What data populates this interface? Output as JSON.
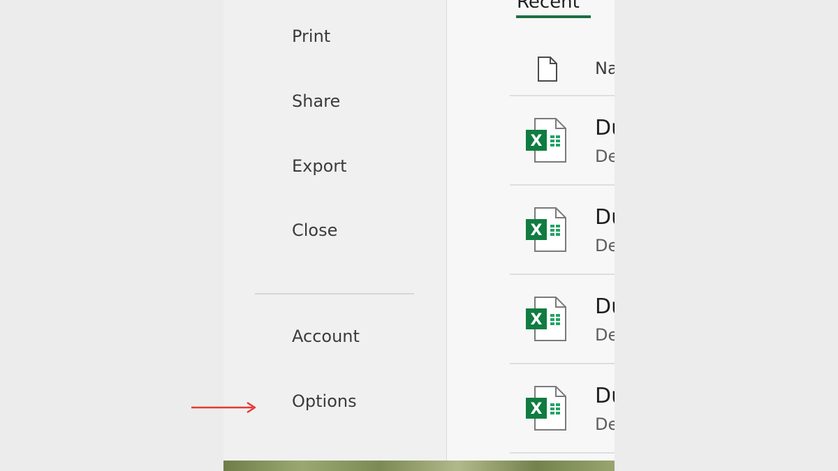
{
  "nav": {
    "items": [
      {
        "label": "Print"
      },
      {
        "label": "Share"
      },
      {
        "label": "Export"
      },
      {
        "label": "Close"
      },
      {
        "label": "Account"
      },
      {
        "label": "Options"
      }
    ]
  },
  "content": {
    "tab_label": "Recent",
    "header_name": "Na",
    "files": [
      {
        "name": "Du",
        "location": "De",
        "icon": "excel-file-icon"
      },
      {
        "name": "Du",
        "location": "De",
        "icon": "excel-file-icon"
      },
      {
        "name": "Du",
        "location": "De",
        "icon": "excel-file-icon"
      },
      {
        "name": "Du",
        "location": "De",
        "icon": "excel-file-icon"
      }
    ]
  },
  "colors": {
    "accent": "#1e6e42",
    "excel_green": "#107c41",
    "annotation_red": "#e53935"
  },
  "icons": {
    "header": "document-icon",
    "annotation": "arrow-right-icon"
  }
}
